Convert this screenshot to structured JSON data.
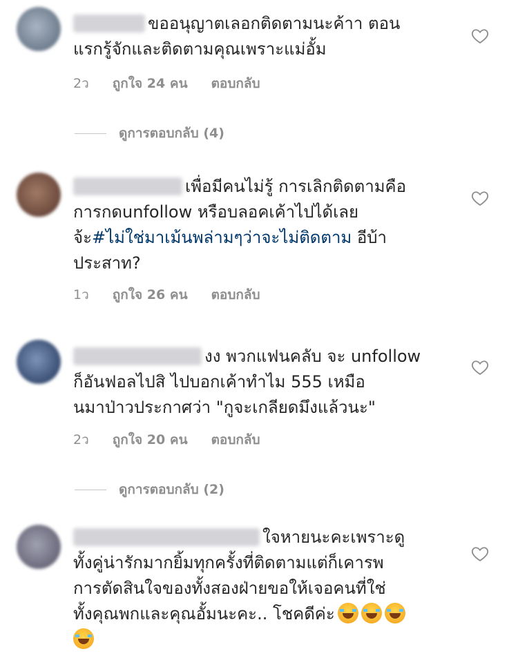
{
  "comments": [
    {
      "text_l1": "ขออนุญาตเลอกติดตามนะค้าา ตอน",
      "text_rest": "แรกรู้จักและติดตามคุณเพราะแม่อั้ม",
      "time": "2ว",
      "likes": "ถูกใจ 24 คน",
      "reply": "ตอบกลับ"
    },
    {
      "text_l1": "เพื่อมีคนไม่รู้ การเลิกติดตามคือ",
      "text_l2": "การกดunfollow หรือบลอคเค้าไปได้เลย",
      "text_l3a": "จ้ะ",
      "hashtag": "#ไม่ใช่มาเม้นพล่ามๆว่าจะไม่ติดตาม",
      "text_l3b": " อีบ้า",
      "text_l4": "ประสาท?",
      "time": "1ว",
      "likes": "ถูกใจ 26 คน",
      "reply": "ตอบกลับ"
    },
    {
      "text_l1": "งง พวกแฟนคลับ จะ unfollow",
      "text_rest": "ก็อันฟอลไปสิ ไปบอกเค้าทำไม 555 เหมือ\nนมาป่าวประกาศว่า \"กูจะเกลียดมึงแล้วนะ\"",
      "time": "2ว",
      "likes": "ถูกใจ 20 คน",
      "reply": "ตอบกลับ"
    },
    {
      "text_l1": "ใจหายนะคะเพราะดู",
      "text_rest": "ทั้งคู่น่ารักมากยิ้มทุกครั้งที่ติดตามแต่ก็เคารพ\nการตัดสินใจของทั้งสองฝ่ายขอให้เจอคนที่ใช่\nทั้งคุณพกและคุณอั้มนะคะ.. โชคดีค่ะ"
    }
  ],
  "view_replies": [
    "ดูการตอบกลับ (4)",
    "ดูการตอบกลับ (2)"
  ],
  "icons": {
    "like": "heart-outline-icon",
    "emoji": "face-with-tears-of-joy-icon"
  }
}
